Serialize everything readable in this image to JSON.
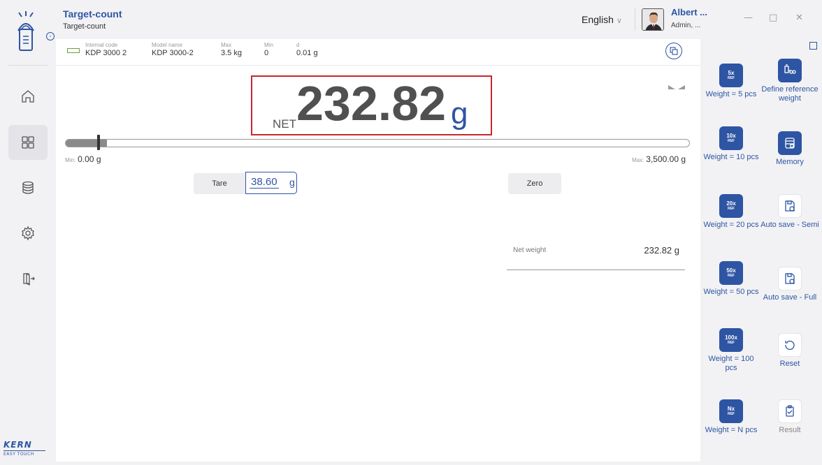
{
  "header": {
    "title": "Target-count",
    "subtitle": "Target-count",
    "language": "English",
    "user_name": "Albert ...",
    "user_role": "Admin, ..."
  },
  "info": {
    "internal_code_label": "Internal code",
    "internal_code": "KDP 3000 2",
    "model_name_label": "Model name",
    "model_name": "KDP 3000-2",
    "max_label": "Max",
    "max": "3.5 kg",
    "min_label": "Min",
    "min": "0",
    "d_label": "d",
    "d": "0.01 g"
  },
  "display": {
    "prefix": "NET",
    "value": "232.82",
    "unit": "g"
  },
  "capacity": {
    "fraction": 0.0665,
    "min_label": "Min:",
    "min_value": "0.00 g",
    "max_label": "Max:",
    "max_value": "3,500.00 g"
  },
  "tare": {
    "label": "Tare",
    "value": "38.60",
    "unit": "g"
  },
  "zero_label": "Zero",
  "net_weight": {
    "label": "Net weight",
    "value": "232.82 g"
  },
  "functions": [
    {
      "icon_top": "5x",
      "icon_bottom": "REF",
      "label": "Weight = 5 pcs"
    },
    {
      "icon_name": "define-reference-icon",
      "label": "Define reference weight"
    },
    {
      "icon_top": "10x",
      "icon_bottom": "REF",
      "label": "Weight = 10 pcs"
    },
    {
      "icon_name": "memory-icon",
      "label": "Memory"
    },
    {
      "icon_top": "20x",
      "icon_bottom": "REF",
      "label": "Weight = 20 pcs"
    },
    {
      "icon_name": "auto-save-semi-icon",
      "label": "Auto save - Semi"
    },
    {
      "icon_top": "50x",
      "icon_bottom": "REF",
      "label": "Weight = 50 pcs"
    },
    {
      "icon_name": "auto-save-full-icon",
      "label": "Auto save - Full"
    },
    {
      "icon_top": "100x",
      "icon_bottom": "REF",
      "label": "Weight = 100 pcs"
    },
    {
      "icon_name": "reset-icon",
      "label": "Reset"
    },
    {
      "icon_top": "Nx",
      "icon_bottom": "REF",
      "label": "Weight = N pcs"
    },
    {
      "icon_name": "result-icon",
      "label": "Result"
    }
  ],
  "brand": {
    "name": "KERN",
    "tagline": "EASY TOUCH"
  },
  "colors": {
    "accent": "#2e55a3",
    "highlight": "#c9262c"
  }
}
